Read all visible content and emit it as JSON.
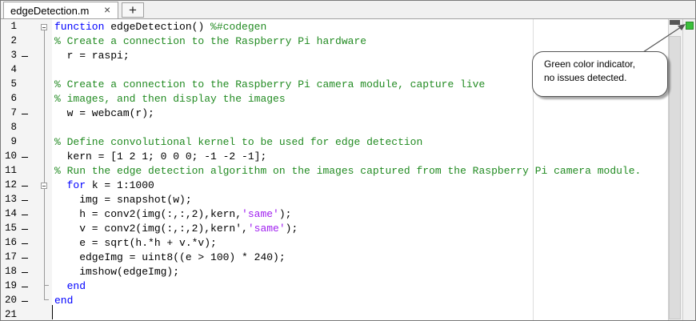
{
  "tab": {
    "label": "edgeDetection.m",
    "close": "×",
    "add": "+"
  },
  "lines": [
    {
      "n": "1"
    },
    {
      "n": "2"
    },
    {
      "n": "3"
    },
    {
      "n": "4"
    },
    {
      "n": "5"
    },
    {
      "n": "6"
    },
    {
      "n": "7"
    },
    {
      "n": "8"
    },
    {
      "n": "9"
    },
    {
      "n": "10"
    },
    {
      "n": "11"
    },
    {
      "n": "12"
    },
    {
      "n": "13"
    },
    {
      "n": "14"
    },
    {
      "n": "15"
    },
    {
      "n": "16"
    },
    {
      "n": "17"
    },
    {
      "n": "18"
    },
    {
      "n": "19"
    },
    {
      "n": "20"
    },
    {
      "n": "21"
    }
  ],
  "code": {
    "l1_kw": "function",
    "l1_rest": " edgeDetection() ",
    "l1_cm": "%#codegen",
    "l2": "% Create a connection to the Raspberry Pi hardware",
    "l3": "  r = raspi;",
    "l5": "% Create a connection to the Raspberry Pi camera module, capture live",
    "l6": "% images, and then display the images",
    "l7": "  w = webcam(r);",
    "l9": "% Define convolutional kernel to be used for edge detection",
    "l10": "  kern = [1 2 1; 0 0 0; -1 -2 -1];",
    "l11": "% Run the edge detection algorithm on the images captured from the Raspberry Pi camera module.",
    "l12_kw": "for",
    "l12_rest": " k = 1:1000",
    "l13": "    img = snapshot(w);",
    "l14_a": "    h = conv2(img(:,:,2),kern,",
    "l14_s": "'same'",
    "l14_b": ");",
    "l15_a": "    v = conv2(img(:,:,2),kern',",
    "l15_s": "'same'",
    "l15_b": ");",
    "l16": "    e = sqrt(h.*h + v.*v);",
    "l17": "    edgeImg = uint8((e > 100) * 240);",
    "l18": "    imshow(edgeImg);",
    "l19_kw": "end",
    "l20_kw": "end"
  },
  "callout": {
    "line1": "Green color indicator,",
    "line2": "no issues detected."
  },
  "colors": {
    "indicator": "#3bbf3b",
    "keyword": "#0000ff",
    "comment": "#228b22",
    "string": "#a020f0"
  }
}
